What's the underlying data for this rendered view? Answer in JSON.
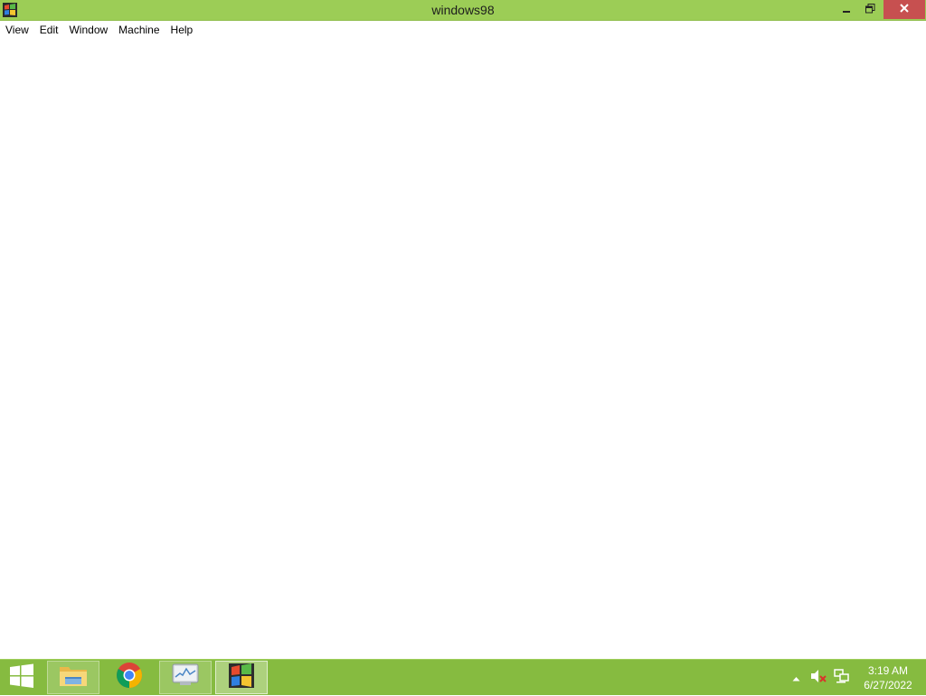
{
  "window": {
    "title": "windows98",
    "icon": "windows-flag-icon",
    "controls": {
      "minimize": "minimize-icon",
      "restore": "restore-icon",
      "close": "close-icon"
    }
  },
  "menu": {
    "items": [
      "View",
      "Edit",
      "Window",
      "Machine",
      "Help"
    ]
  },
  "taskbar": {
    "start": "start-windows-icon",
    "apps": [
      {
        "name": "File Explorer",
        "icon": "folder-icon",
        "state": "pinned"
      },
      {
        "name": "Google Chrome",
        "icon": "chrome-icon",
        "state": "normal"
      },
      {
        "name": "Resource Monitor",
        "icon": "monitor-icon",
        "state": "pinned"
      },
      {
        "name": "windows98",
        "icon": "windows-flag-icon",
        "state": "active"
      }
    ],
    "tray": {
      "show_hidden": "up-arrow-icon",
      "volume": "muted-speaker-icon",
      "network": "network-icon",
      "time": "3:19 AM",
      "date": "6/27/2022"
    }
  },
  "colors": {
    "titlebar": "#9ccd56",
    "taskbar": "#86bb40",
    "close_button": "#c75050"
  }
}
